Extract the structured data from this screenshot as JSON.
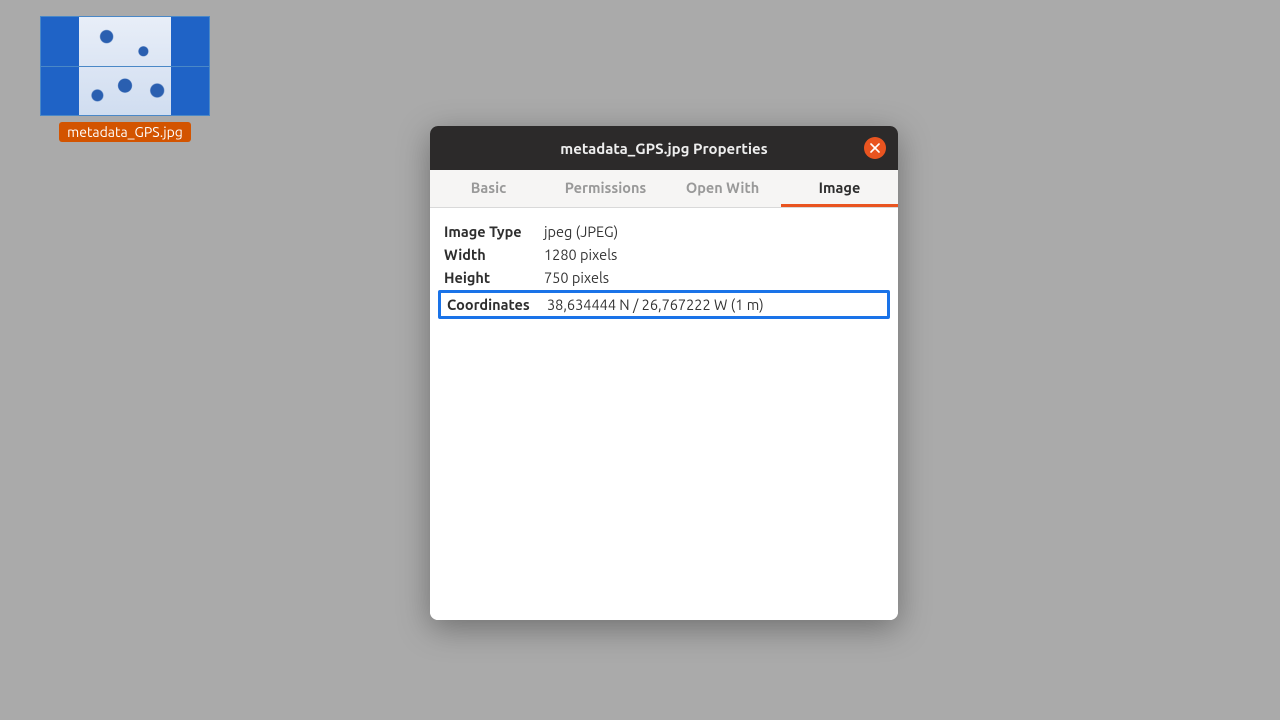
{
  "desktop": {
    "file_label": "metadata_GPS.jpg"
  },
  "dialog": {
    "title": "metadata_GPS.jpg Properties",
    "tabs": {
      "basic": "Basic",
      "permissions": "Permissions",
      "open_with": "Open With",
      "image": "Image"
    },
    "props": {
      "image_type_label": "Image Type",
      "image_type_value": "jpeg (JPEG)",
      "width_label": "Width",
      "width_value": "1280 pixels",
      "height_label": "Height",
      "height_value": "750 pixels",
      "coords_label": "Coordinates",
      "coords_value": "38,634444 N / 26,767222 W (1 m)"
    }
  },
  "colors": {
    "accent": "#e95420",
    "highlight": "#1a73e8"
  }
}
